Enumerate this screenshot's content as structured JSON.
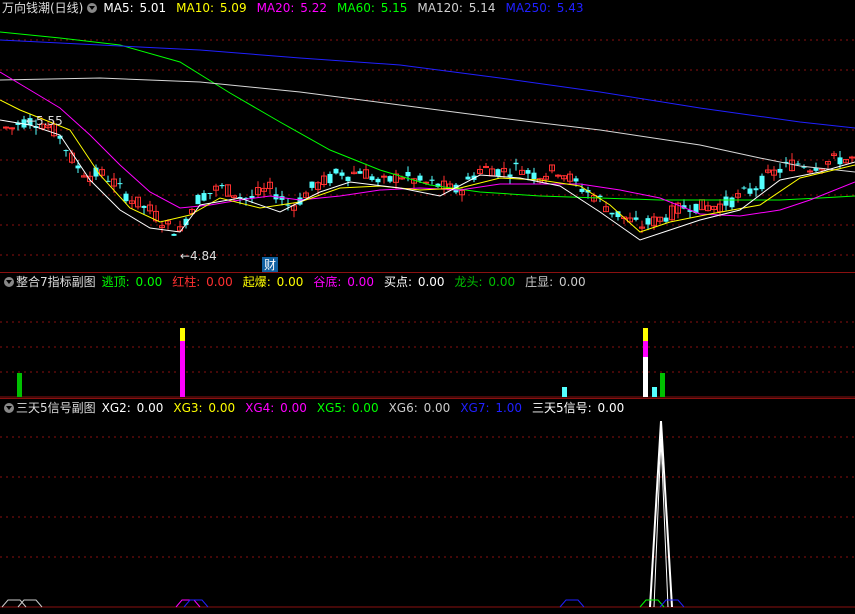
{
  "main": {
    "title": "万向钱潮(日线)",
    "ma": [
      {
        "label": "MA5: ",
        "value": "5.01",
        "color": "#ffffff"
      },
      {
        "label": "MA10: ",
        "value": "5.09",
        "color": "#ffff00"
      },
      {
        "label": "MA20: ",
        "value": "5.22",
        "color": "#ff00ff"
      },
      {
        "label": "MA60: ",
        "value": "5.15",
        "color": "#00ff00"
      },
      {
        "label": "MA120: ",
        "value": "5.14",
        "color": "#d0d0d0"
      },
      {
        "label": "MA250: ",
        "value": "5.43",
        "color": "#2020ff"
      }
    ],
    "high_label": "5.55",
    "low_label": "4.84",
    "cai_label": "财"
  },
  "sub1": {
    "title": "整合7指标副图",
    "items": [
      {
        "label": "逃顶: ",
        "value": "0.00",
        "color": "#00ff00"
      },
      {
        "label": "红柱: ",
        "value": "0.00",
        "color": "#ff3030"
      },
      {
        "label": "起爆: ",
        "value": "0.00",
        "color": "#ffff00"
      },
      {
        "label": "谷底: ",
        "value": "0.00",
        "color": "#ff00ff"
      },
      {
        "label": "买点: ",
        "value": "0.00",
        "color": "#ffffff"
      },
      {
        "label": "龙头: ",
        "value": "0.00",
        "color": "#00c000"
      },
      {
        "label": "庄显: ",
        "value": "0.00",
        "color": "#cccccc"
      }
    ]
  },
  "sub2": {
    "title": "三天5信号副图",
    "items": [
      {
        "label": "XG2: ",
        "value": "0.00",
        "color": "#ffffff"
      },
      {
        "label": "XG3: ",
        "value": "0.00",
        "color": "#ffff00"
      },
      {
        "label": "XG4: ",
        "value": "0.00",
        "color": "#ff00ff"
      },
      {
        "label": "XG5: ",
        "value": "0.00",
        "color": "#00ff00"
      },
      {
        "label": "XG6: ",
        "value": "0.00",
        "color": "#cccccc"
      },
      {
        "label": "XG7: ",
        "value": "1.00",
        "color": "#2020ff"
      },
      {
        "label": "三天5信号: ",
        "value": "0.00",
        "color": "#ffffff"
      }
    ]
  },
  "colors": {
    "up": "#ff3030",
    "down": "#54ffff",
    "grid": "#8a1010",
    "bg": "#000000"
  }
}
